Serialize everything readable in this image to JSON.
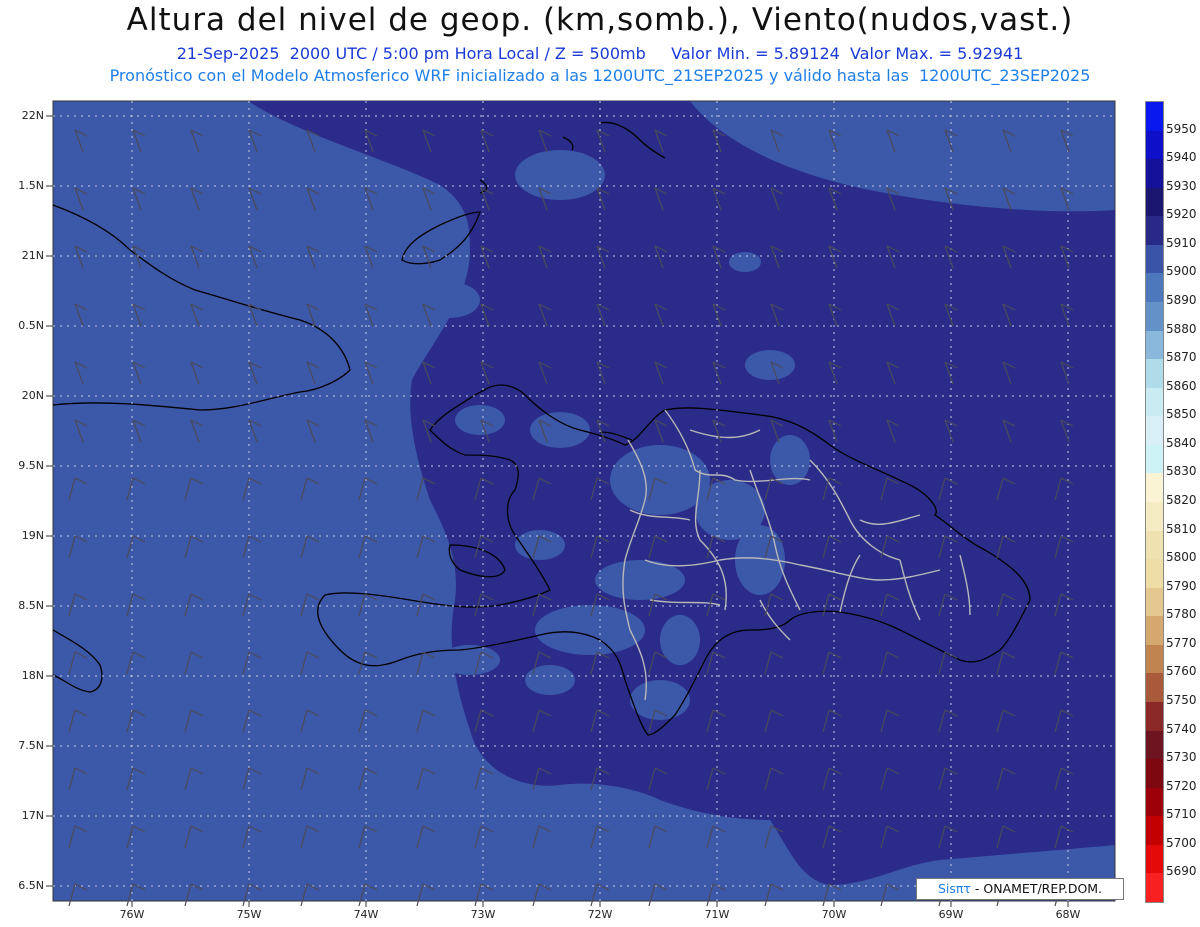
{
  "title": "Altura del nivel de geop. (km,somb.), Viento(nudos,vast.)",
  "subtitle": "21-Sep-2025  2000 UTC / 5:00 pm Hora Local / Z = 500mb     Valor Min. = 5.89124  Valor Max. = 5.92941",
  "subtitle2": "Pronóstico con el Modelo Atmosferico WRF inicializado a las 1200UTC_21SEP2025 y válido hasta las  1200UTC_23SEP2025",
  "lat_labels": [
    "22N",
    "1.5N",
    "21N",
    "0.5N",
    "20N",
    "9.5N",
    "19N",
    "8.5N",
    "18N",
    "7.5N",
    "17N",
    "6.5N"
  ],
  "lon_labels": [
    "76W",
    "75W",
    "74W",
    "73W",
    "72W",
    "71W",
    "70W",
    "69W",
    "68W"
  ],
  "colorbar": {
    "labels": [
      "5950",
      "5940",
      "5930",
      "5920",
      "5910",
      "5900",
      "5890",
      "5880",
      "5870",
      "5860",
      "5850",
      "5840",
      "5830",
      "5820",
      "5810",
      "5800",
      "5790",
      "5780",
      "5770",
      "5760",
      "5750",
      "5740",
      "5730",
      "5720",
      "5710",
      "5700",
      "5690"
    ],
    "colors": [
      "#0a18f0",
      "#0d10c8",
      "#14109a",
      "#1a1670",
      "#292a88",
      "#3a55a8",
      "#4d78bc",
      "#6392c8",
      "#8ab8dc",
      "#b0dce9",
      "#c9ecf2",
      "#d9f0f6",
      "#cdf3f6",
      "#fbf4d4",
      "#f5ecc4",
      "#efe2b0",
      "#eedda6",
      "#e4c890",
      "#d5a870",
      "#bf8450",
      "#a85a3a",
      "#8a2828",
      "#6e1420",
      "#7e0810",
      "#9c0008",
      "#c20000",
      "#e40a0a",
      "#f82020"
    ]
  },
  "colors": {
    "field_main": "#2b2c8a",
    "field_light": "#3c58a8",
    "field_lighter": "#4a6fb8",
    "grid": "#c8cce6",
    "coast": "#000000",
    "border": "#b8b8b8"
  },
  "credit": {
    "brand": "Sisπτ",
    "text": " - ONAMET/REP.DOM."
  }
}
